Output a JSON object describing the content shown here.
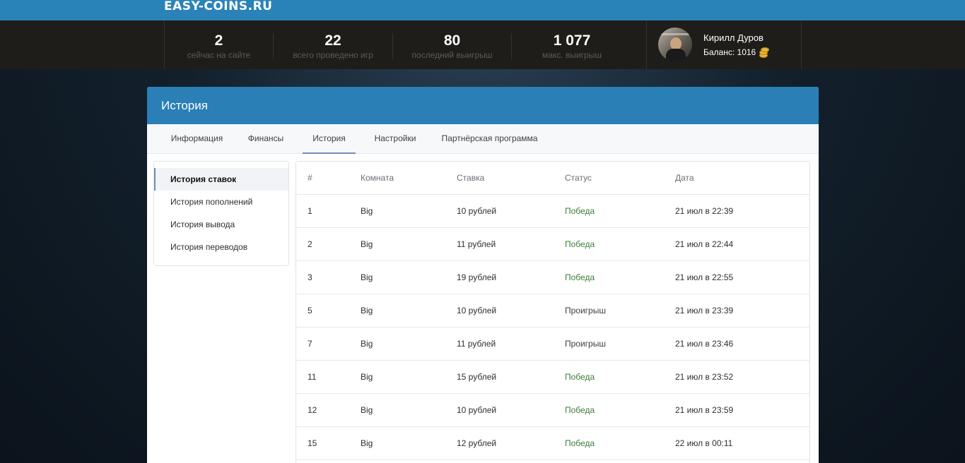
{
  "site": {
    "logo": "EASY-COINS.RU"
  },
  "stats": [
    {
      "value": "2",
      "label": "сейчас на сайте"
    },
    {
      "value": "22",
      "label": "всего проведено игр"
    },
    {
      "value": "80",
      "label": "последний выигрыш"
    },
    {
      "value": "1 077",
      "label": "макс. выигрыш"
    }
  ],
  "user": {
    "name": "Кирилл Дуров",
    "balance": "Баланс: 1016",
    "coin_icon": "coins-icon"
  },
  "card": {
    "title": "История",
    "tabs": [
      "Информация",
      "Финансы",
      "История",
      "Настройки",
      "Партнёрская программа"
    ],
    "active_tab": "История"
  },
  "side_menu": {
    "items": [
      "История ставок",
      "История пополнений",
      "История вывода",
      "История переводов"
    ],
    "active": "История ставок"
  },
  "table": {
    "headers": [
      "#",
      "Комната",
      "Ставка",
      "Статус",
      "Дата"
    ],
    "rows": [
      [
        "1",
        "Big",
        "10 рублей",
        "Победа",
        "21 июл в 22:39"
      ],
      [
        "2",
        "Big",
        "11 рублей",
        "Победа",
        "21 июл в 22:44"
      ],
      [
        "3",
        "Big",
        "19 рублей",
        "Победа",
        "21 июл в 22:55"
      ],
      [
        "5",
        "Big",
        "10 рублей",
        "Проигрыш",
        "21 июл в 23:39"
      ],
      [
        "7",
        "Big",
        "11 рублей",
        "Проигрыш",
        "21 июл в 23:46"
      ],
      [
        "11",
        "Big",
        "15 рублей",
        "Победа",
        "21 июл в 23:52"
      ],
      [
        "12",
        "Big",
        "10 рублей",
        "Победа",
        "21 июл в 23:59"
      ],
      [
        "15",
        "Big",
        "12 рублей",
        "Победа",
        "22 июл в 00:11"
      ]
    ]
  },
  "colors": {
    "accent": "#2a83b8",
    "win": "#3a7e3a",
    "statsbar": "#1f1d19"
  }
}
